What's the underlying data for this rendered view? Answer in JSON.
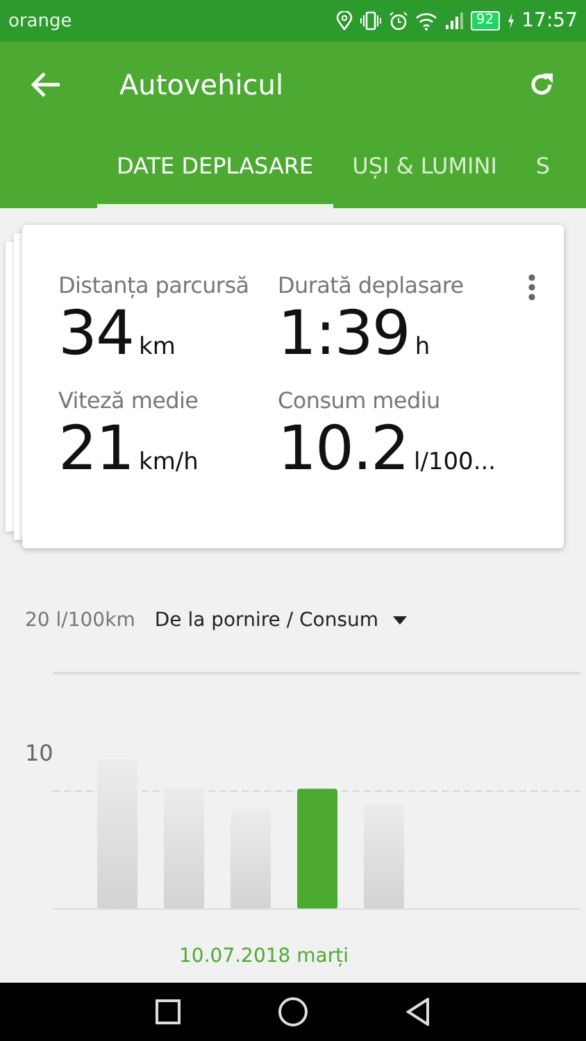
{
  "status_bar": {
    "carrier": "orange",
    "battery": "92",
    "time": "17:57"
  },
  "app_bar": {
    "title": "Autovehicul"
  },
  "tabs": [
    {
      "label": "DATE DEPLASARE",
      "selected": true
    },
    {
      "label": "UȘI & LUMINI",
      "selected": false
    },
    {
      "label": "S",
      "selected": false
    }
  ],
  "stats": [
    {
      "label": "Distanța parcursă",
      "value": "34",
      "unit": "km"
    },
    {
      "label": "Durată deplasare",
      "value": "1:39",
      "unit": "h"
    },
    {
      "label": "Viteză medie",
      "value": "21",
      "unit": "km/h"
    },
    {
      "label": "Consum mediu",
      "value": "10.2",
      "unit": "l/100..."
    }
  ],
  "chart": {
    "selector": "De la pornire / Consum",
    "date": "10.07.2018 marți",
    "bars": [
      {
        "selected": false
      },
      {
        "selected": false
      },
      {
        "selected": false
      },
      {
        "selected": true
      },
      {
        "selected": false
      }
    ],
    "top_label": "20 l/100km",
    "mid_label": "10"
  }
}
